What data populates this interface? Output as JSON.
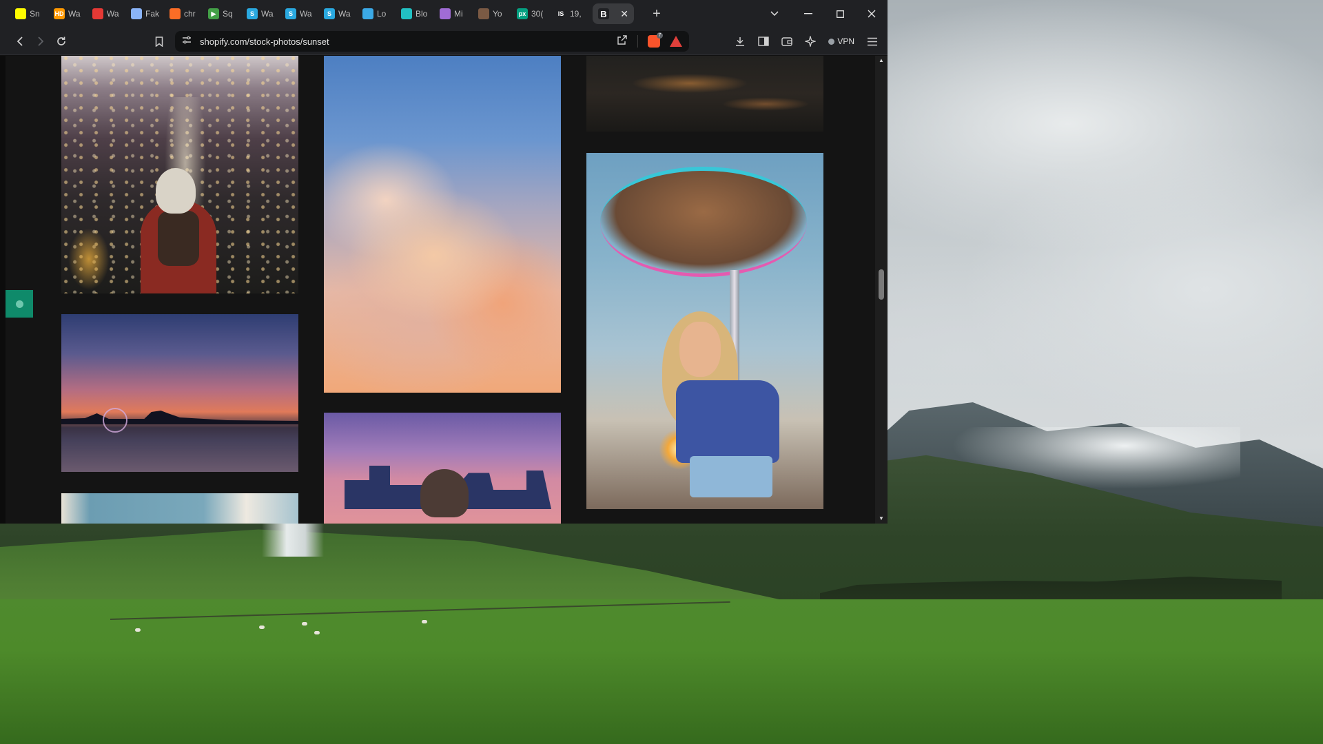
{
  "browser": {
    "tabs": [
      {
        "label": "Sn",
        "icon": "snapchat-icon",
        "color": "#fffc00",
        "glyph": ""
      },
      {
        "label": "Wa",
        "icon": "hd-icon",
        "color": "#ff9900",
        "glyph": "HD"
      },
      {
        "label": "Wa",
        "icon": "grid-icon",
        "color": "#e53935",
        "glyph": ""
      },
      {
        "label": "Fak",
        "icon": "document-icon",
        "color": "#8ab4f8",
        "glyph": ""
      },
      {
        "label": "chr",
        "icon": "gitlab-icon",
        "color": "#fc6d26",
        "glyph": ""
      },
      {
        "label": "Sq",
        "icon": "play-icon",
        "color": "#43a047",
        "glyph": "▶"
      },
      {
        "label": "Wa",
        "icon": "s-logo-icon",
        "color": "#2aa9e0",
        "glyph": "S"
      },
      {
        "label": "Wa",
        "icon": "s-logo-icon",
        "color": "#2aa9e0",
        "glyph": "S"
      },
      {
        "label": "Wa",
        "icon": "s-logo-icon",
        "color": "#2aa9e0",
        "glyph": "S"
      },
      {
        "label": "Lo",
        "icon": "cloud-icon",
        "color": "#3ba9e6",
        "glyph": ""
      },
      {
        "label": "Blo",
        "icon": "square-logo-icon",
        "color": "#22c1c3",
        "glyph": ""
      },
      {
        "label": "Mi",
        "icon": "copilot-icon",
        "color": "#a06cd5",
        "glyph": ""
      },
      {
        "label": "Yo",
        "icon": "avatar-icon",
        "color": "#7b5a44",
        "glyph": ""
      },
      {
        "label": "30(",
        "icon": "px-icon",
        "color": "#05a081",
        "glyph": "px"
      },
      {
        "label": "19,",
        "icon": "is-logo-icon",
        "color": "#202124",
        "glyph": "IS"
      }
    ],
    "active_tab": {
      "icon": "b-logo-icon",
      "glyph": "B",
      "close": "✕"
    },
    "new_tab": "+",
    "url": "shopify.com/stock-photos/sunset",
    "brave_badge": "7",
    "vpn_label": "VPN"
  },
  "page": {
    "photos": [
      {
        "name": "city-night-hood-photo"
      },
      {
        "name": "pink-clouds-photo"
      },
      {
        "name": "dark-water-photo"
      },
      {
        "name": "sunset-harbor-photo"
      },
      {
        "name": "carousel-woman-photo"
      },
      {
        "name": "dusk-photographer-photo"
      },
      {
        "name": "glacier-photo"
      }
    ]
  },
  "colors": {
    "feedback_tab": "#0f8a6a",
    "tabbar": "#202124",
    "page_bg": "#141414"
  }
}
